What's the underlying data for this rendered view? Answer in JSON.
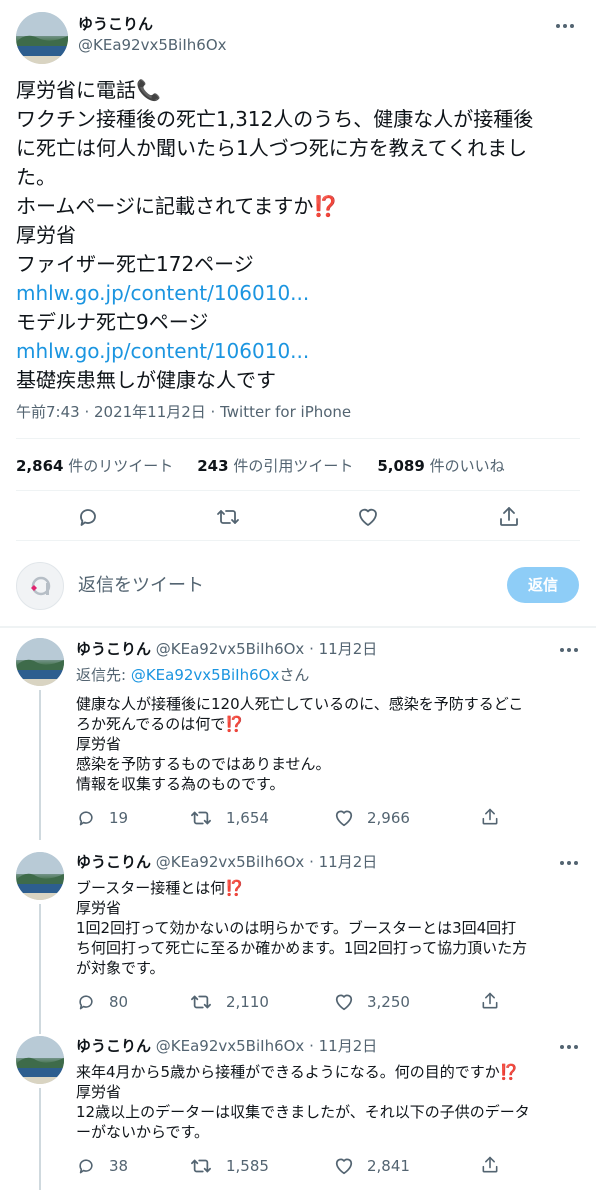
{
  "main_tweet": {
    "display_name": "ゆうこりん",
    "handle": "@KEa92vx5BiIh6Ox",
    "lines": [
      "厚労省に電話📞",
      "ワクチン接種後の死亡1,312人のうち、健康な人が接種後",
      "に死亡は何人か聞いたら1人づつ死に方を教えてくれまし",
      "た。",
      "ホームページに記載されてますか⁉️",
      "厚労省",
      "ファイザー死亡172ページ"
    ],
    "link1": "mhlw.go.jp/content/106010...",
    "line_moderna": "モデルナ死亡9ページ",
    "link2": "mhlw.go.jp/content/106010...",
    "line_last": "基礎疾患無しが健康な人です",
    "meta": "午前7:43 · 2021年11月2日 · Twitter for iPhone",
    "stats": {
      "retweets_count": "2,864",
      "retweets_label": "件のリツイート",
      "quotes_count": "243",
      "quotes_label": "件の引用ツイート",
      "likes_count": "5,089",
      "likes_label": "件のいいね"
    }
  },
  "compose": {
    "placeholder": "返信をツイート",
    "button": "返信"
  },
  "replies": [
    {
      "display_name": "ゆうこりん",
      "handle_date": "@KEa92vx5BiIh6Ox · 11月2日",
      "reply_to_label": "返信先: ",
      "reply_to_handle": "@KEa92vx5BiIh6Ox",
      "reply_to_suffix": "さん",
      "lines": [
        "健康な人が接種後に120人死亡しているのに、感染を予防するどこ",
        "ろか死んでるのは何で⁉️",
        "厚労省",
        "感染を予防するものではありません。",
        "情報を収集する為のものです。"
      ],
      "replies": "19",
      "retweets": "1,654",
      "likes": "2,966"
    },
    {
      "display_name": "ゆうこりん",
      "handle_date": "@KEa92vx5BiIh6Ox · 11月2日",
      "lines": [
        "ブースター接種とは何⁉️",
        "厚労省",
        "1回2回打って効かないのは明らかです。ブースターとは3回4回打",
        "ち何回打って死亡に至るか確かめます。1回2回打って協力頂いた方",
        "が対象です。"
      ],
      "replies": "80",
      "retweets": "2,110",
      "likes": "3,250"
    },
    {
      "display_name": "ゆうこりん",
      "handle_date": "@KEa92vx5BiIh6Ox · 11月2日",
      "lines": [
        "来年4月から5歳から接種ができるようになる。何の目的ですか⁉️",
        "厚労省",
        "12歳以上のデーターは収集できましたが、それ以下の子供のデータ",
        "ーがないからです。"
      ],
      "replies": "38",
      "retweets": "1,585",
      "likes": "2,841"
    }
  ],
  "colors": {
    "text": "#0f1419",
    "muted": "#536471",
    "link": "#1b95e0",
    "reply_button": "#8ecdf7",
    "divider": "#eff3f4"
  }
}
